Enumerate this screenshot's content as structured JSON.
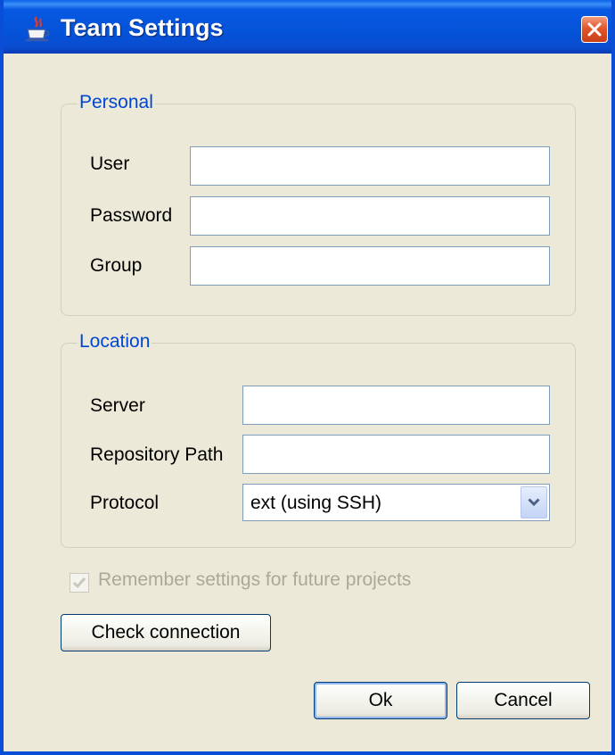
{
  "window": {
    "title": "Team Settings"
  },
  "personal": {
    "legend": "Personal",
    "user_label": "User",
    "user_value": "",
    "password_label": "Password",
    "password_value": "",
    "group_label": "Group",
    "group_value": ""
  },
  "location": {
    "legend": "Location",
    "server_label": "Server",
    "server_value": "",
    "repository_label": "Repository Path",
    "repository_value": "",
    "protocol_label": "Protocol",
    "protocol_value": "ext (using SSH)"
  },
  "remember": {
    "label": "Remember settings for future projects",
    "checked": true,
    "enabled": false
  },
  "buttons": {
    "check_connection": "Check connection",
    "ok": "Ok",
    "cancel": "Cancel"
  },
  "colors": {
    "titlebar": "#0453d8",
    "legend": "#0046d5",
    "dialog_bg": "#ece9d8",
    "close_button": "#e2562a"
  },
  "icons": {
    "app": "java-cup-icon",
    "close": "close-icon",
    "dropdown": "chevron-down-icon",
    "check": "check-icon"
  }
}
